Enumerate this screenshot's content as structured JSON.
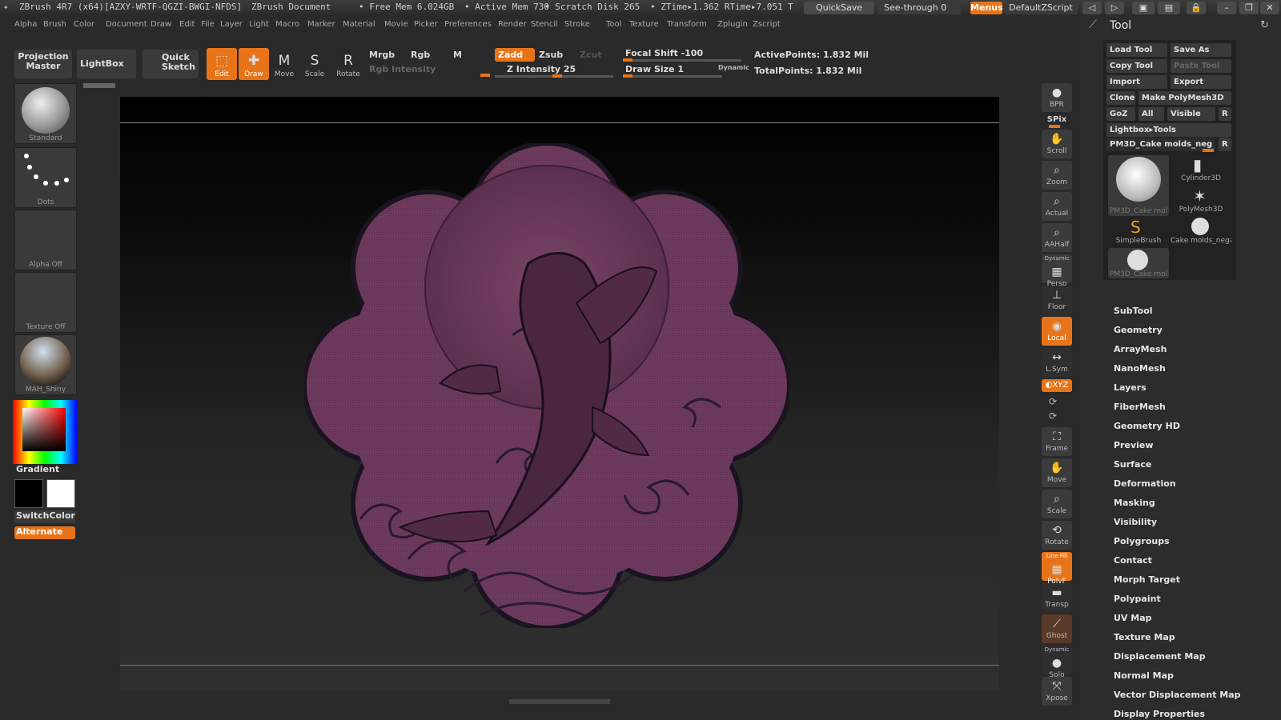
{
  "titlebar": {
    "app": "ZBrush 4R7 (x64)[AZXY-WRTF-QGZI-BWGI-NFDS]",
    "document": "ZBrush Document",
    "free_mem": "• Free Mem 6.024GB",
    "active_mem": "• Active Mem 730",
    "scratch": "• Scratch Disk 265",
    "ztime": "• ZTime▸1.362  RTime▸7.051  T",
    "quicksave": "QuickSave",
    "seethrough": "See-through   0",
    "menus": "Menus",
    "zscript": "DefaultZScript"
  },
  "menubar": [
    "Alpha",
    "Brush",
    "Color",
    "Document",
    "Draw",
    "Edit",
    "File",
    "Layer",
    "Light",
    "Macro",
    "Marker",
    "Material",
    "Movie",
    "Picker",
    "Preferences",
    "Render",
    "Stencil",
    "Stroke",
    "Tool",
    "Texture",
    "Transform",
    "Zplugin",
    "Zscript"
  ],
  "toolbar": {
    "projection_master": "Projection Master",
    "lightbox": "LightBox",
    "quick_sketch": "Quick Sketch",
    "edit": "Edit",
    "draw": "Draw",
    "move": "Move",
    "scale": "Scale",
    "rotate": "Rotate",
    "mrgb": "Mrgb",
    "rgb": "Rgb",
    "m": "M",
    "rgb_intensity": "Rgb  Intensity",
    "zadd": "Zadd",
    "zsub": "Zsub",
    "zcut": "Zcut",
    "z_intensity": "Z Intensity 25",
    "focal_shift": "Focal Shift -100",
    "draw_size": "Draw Size 1",
    "dynamic": "Dynamic",
    "active_points": "ActivePoints: 1.832  Mil",
    "total_points": "TotalPoints: 1.832  Mil"
  },
  "left": {
    "brush": "Standard",
    "stroke": "Dots",
    "alpha": "Alpha  Off",
    "texture": "Texture  Off",
    "material": "MAH_Shiny",
    "gradient": "Gradient",
    "switchcolor": "SwitchColor",
    "alternate": "Alternate"
  },
  "shelf": {
    "bpr": "BPR",
    "spix": "SPix",
    "scroll": "Scroll",
    "zoom": "Zoom",
    "actual": "Actual",
    "aahalf": "AAHalf",
    "dynamic": "Dynamic",
    "persp": "Persp",
    "floor": "Floor",
    "local": "Local",
    "lsym": "L.Sym",
    "xyz": "◐XYZ",
    "frame": "Frame",
    "move": "Move",
    "scale": "Scale",
    "rotate": "Rotate",
    "linefill": "Line Fill",
    "polyf": "PolyF",
    "transp": "Transp",
    "ghost": "Ghost",
    "solo_dynamic": "Dynamic",
    "solo": "Solo",
    "xpose": "Xpose"
  },
  "toolpanel": {
    "title": "Tool",
    "load_tool": "Load Tool",
    "save_as": "Save As",
    "copy_tool": "Copy Tool",
    "paste_tool": "Paste Tool",
    "import": "Import",
    "export": "Export",
    "clone": "Clone",
    "make_polymesh": "Make PolyMesh3D",
    "goz": "GoZ",
    "all": "All",
    "visible": "Visible",
    "r": "R",
    "lightbox_tools": "Lightbox▸Tools",
    "current_tool": "PM3D_Cake molds_neg",
    "r2": "R",
    "thumbs": [
      "PM3D_Cake mol",
      "Cylinder3D",
      "PolyMesh3D",
      "SimpleBrush",
      "Cake molds_nega",
      "PM3D_Cake mol"
    ],
    "sections": [
      "SubTool",
      "Geometry",
      "ArrayMesh",
      "NanoMesh",
      "Layers",
      "FiberMesh",
      "Geometry HD",
      "Preview",
      "Surface",
      "Deformation",
      "Masking",
      "Visibility",
      "Polygroups",
      "Contact",
      "Morph Target",
      "Polypaint",
      "UV Map",
      "Texture Map",
      "Displacement Map",
      "Normal Map",
      "Vector Displacement Map",
      "Display Properties"
    ]
  },
  "colors": {
    "accent": "#e8741a",
    "mesh": "#6e3a5e",
    "panel": "#2c2c2c"
  }
}
